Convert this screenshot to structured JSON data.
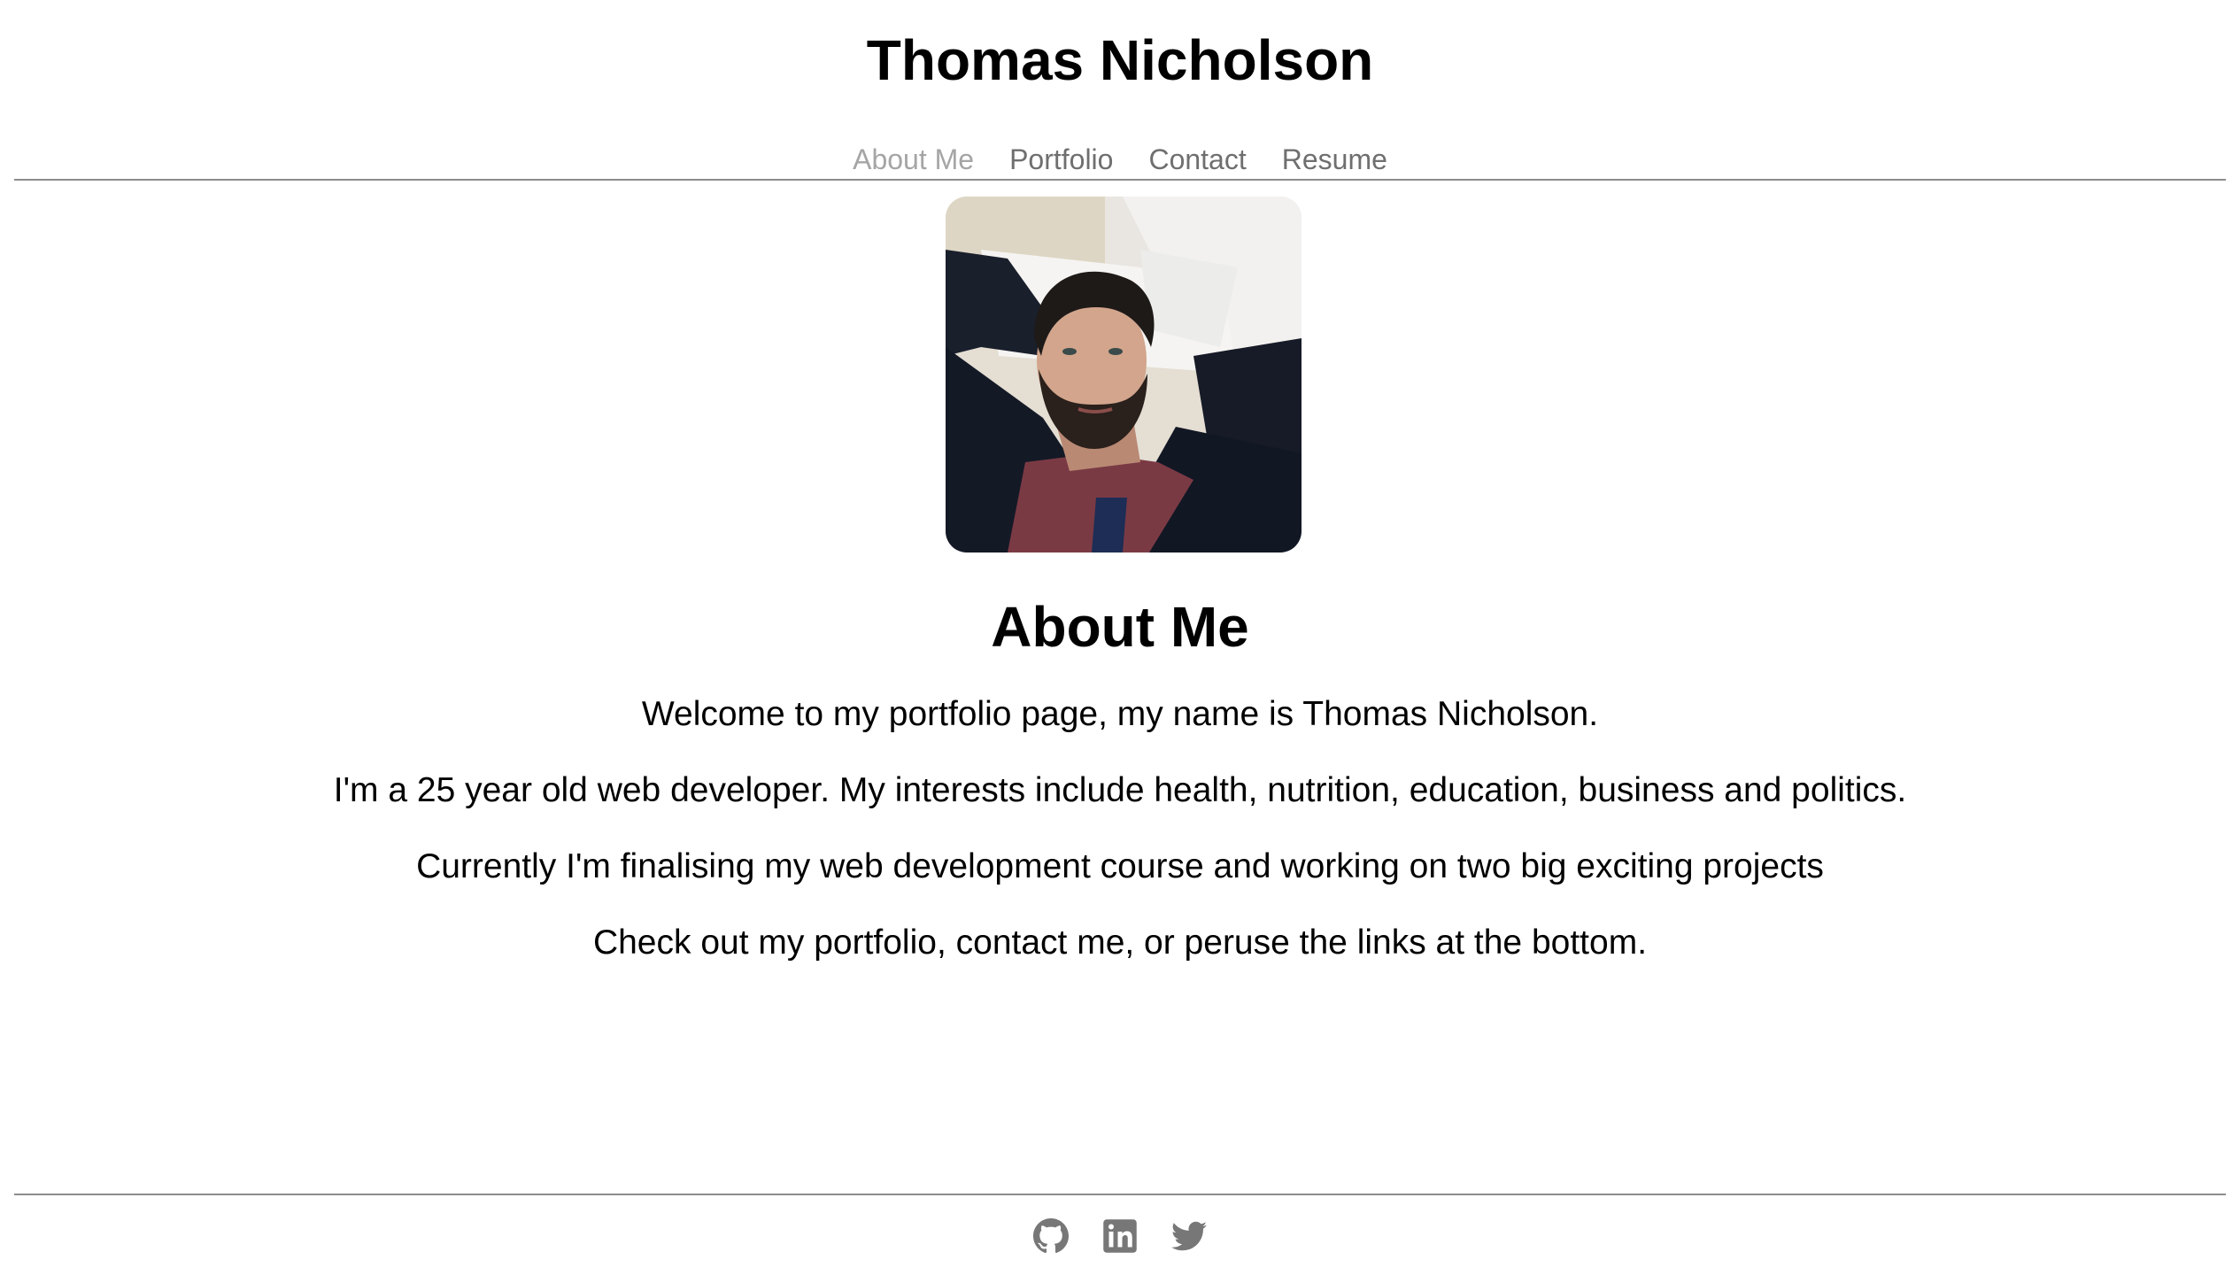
{
  "header": {
    "title": "Thomas Nicholson"
  },
  "nav": {
    "items": [
      {
        "label": "About Me",
        "active": true
      },
      {
        "label": "Portfolio",
        "active": false
      },
      {
        "label": "Contact",
        "active": false
      },
      {
        "label": "Resume",
        "active": false
      }
    ]
  },
  "main": {
    "heading": "About Me",
    "paragraphs": [
      "Welcome to my portfolio page, my name is Thomas Nicholson.",
      "I'm a 25 year old web developer. My interests include health, nutrition, education, business and politics.",
      "Currently I'm finalising my web development course and working on two big exciting projects",
      "Check out my portfolio, contact me, or peruse the links at the bottom."
    ]
  },
  "footer": {
    "icons": [
      "github-icon",
      "linkedin-icon",
      "twitter-icon"
    ]
  },
  "colors": {
    "nav_link": "#6f6f6f",
    "nav_active": "#a5a5a5",
    "divider": "#8c8c8c",
    "social_icon": "#777777"
  }
}
